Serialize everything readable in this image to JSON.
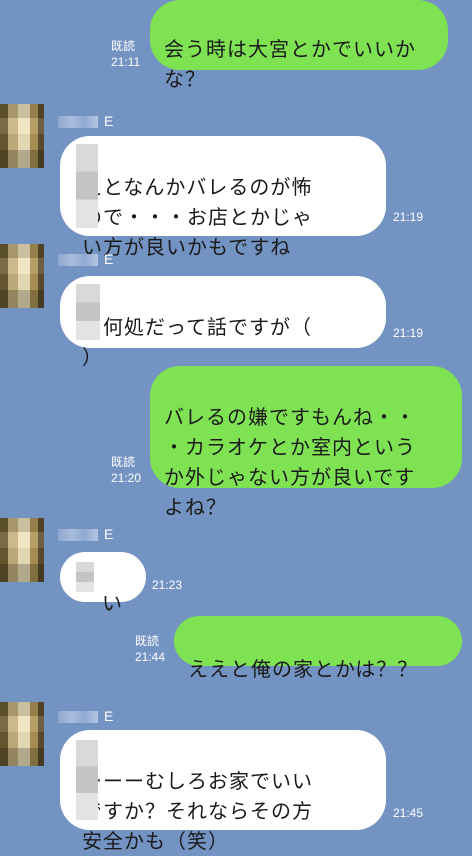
{
  "messages": [
    {
      "text": "会う時は大宮とかでいいかな？",
      "read": "既読",
      "time": "21:11"
    },
    {
      "name_suffix": "E",
      "text": "えとなんかバレるのが怖\nので・・・お店とかじゃ\nい方が良いかもですね",
      "time": "21:19"
    },
    {
      "name_suffix": "E",
      "text": "ゃ何処だって話ですが（\n）",
      "time": "21:19"
    },
    {
      "text": "バレるの嫌ですもんね・・\n・カラオケとか室内という\nか外じゃない方が良いです\nよね？",
      "read": "既読",
      "time": "21:20"
    },
    {
      "name_suffix": "E",
      "text": "い",
      "time": "21:23"
    },
    {
      "text": "ええと俺の家とかは？？",
      "read": "既読",
      "time": "21:44"
    },
    {
      "name_suffix": "E",
      "text": "ーーーむしろお家でいい\nですか？それならその方\n安全かも（笑）",
      "time": "21:45"
    }
  ]
}
